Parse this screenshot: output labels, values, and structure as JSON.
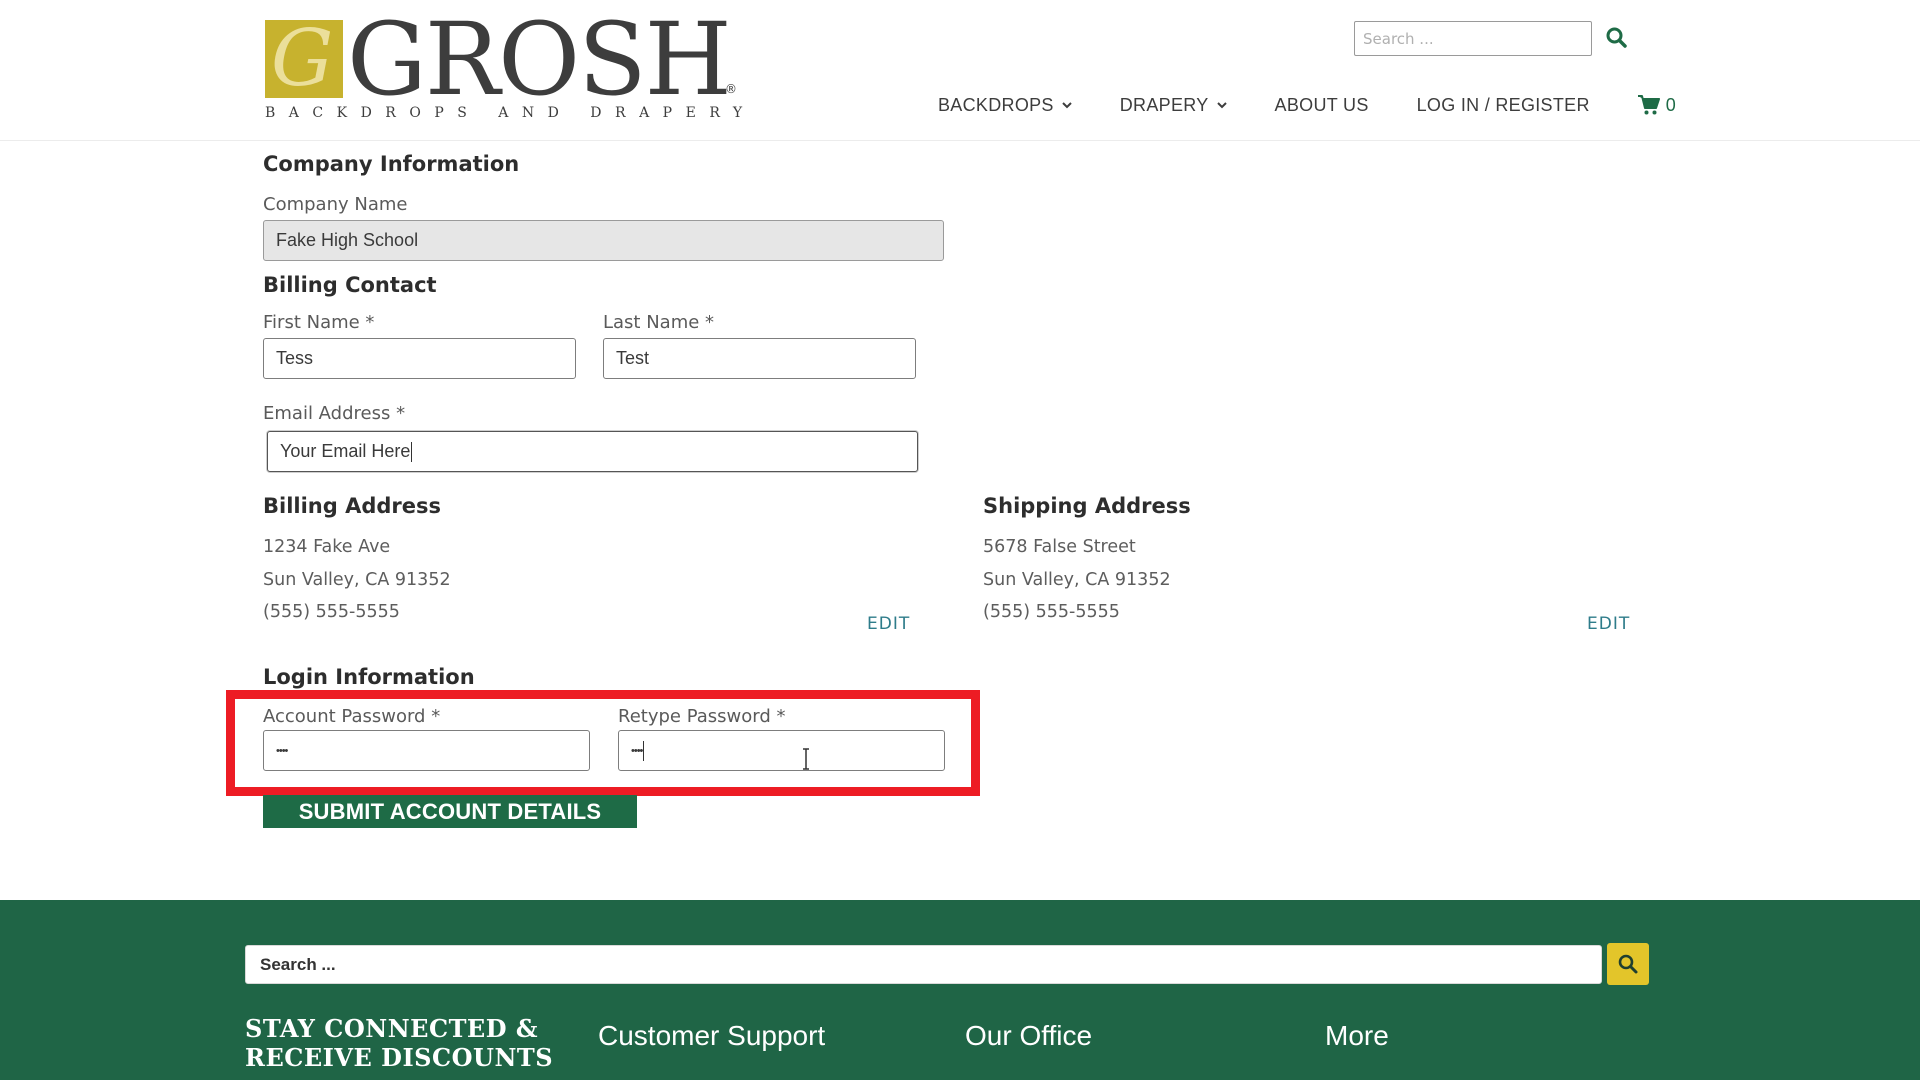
{
  "header": {
    "logo": {
      "wordmark": "GROSH",
      "registered": "®",
      "monogram": "G",
      "tagline": "BACKDROPS AND DRAPERY"
    },
    "search_placeholder": "Search ...",
    "nav": [
      {
        "label": "BACKDROPS",
        "has_dropdown": true
      },
      {
        "label": "DRAPERY",
        "has_dropdown": true
      },
      {
        "label": "ABOUT US",
        "has_dropdown": false
      },
      {
        "label": "LOG IN / REGISTER",
        "has_dropdown": false
      }
    ],
    "cart_count": "0"
  },
  "form": {
    "company": {
      "heading": "Company Information",
      "name_label": "Company Name",
      "name_value": "Fake High School"
    },
    "billing_contact": {
      "heading": "Billing Contact",
      "first_name_label": "First Name *",
      "first_name_value": "Tess",
      "last_name_label": "Last Name *",
      "last_name_value": "Test",
      "email_label": "Email Address *",
      "email_value": "Your Email Here"
    },
    "billing_address": {
      "heading": "Billing Address",
      "line1": "1234 Fake Ave",
      "line2": "Sun Valley, CA 91352",
      "phone": "(555) 555-5555",
      "edit_label": "EDIT"
    },
    "shipping_address": {
      "heading": "Shipping Address",
      "line1": "5678 False Street",
      "line2": "Sun Valley, CA 91352",
      "phone": "(555) 555-5555",
      "edit_label": "EDIT"
    },
    "login": {
      "heading": "Login Information",
      "password_label": "Account Password *",
      "password_value": "••••",
      "retype_label": "Retype Password *",
      "retype_value": "••••"
    },
    "submit_label": "SUBMIT ACCOUNT DETAILS"
  },
  "footer": {
    "search_placeholder": "Search ...",
    "stay_line1": "STAY CONNECTED &",
    "stay_line2": "RECEIVE DISCOUNTS",
    "columns": [
      "Customer Support",
      "Our Office",
      "More"
    ]
  },
  "colors": {
    "brand_green": "#1e6b46",
    "logo_gold": "#c7b22e",
    "highlight_red": "#ed1c24",
    "footer_search_button": "#e3c52a",
    "edit_link": "#2e7c8a"
  },
  "icons": [
    "search-icon",
    "chevron-down-icon",
    "cart-icon",
    "text-cursor-icon"
  ]
}
